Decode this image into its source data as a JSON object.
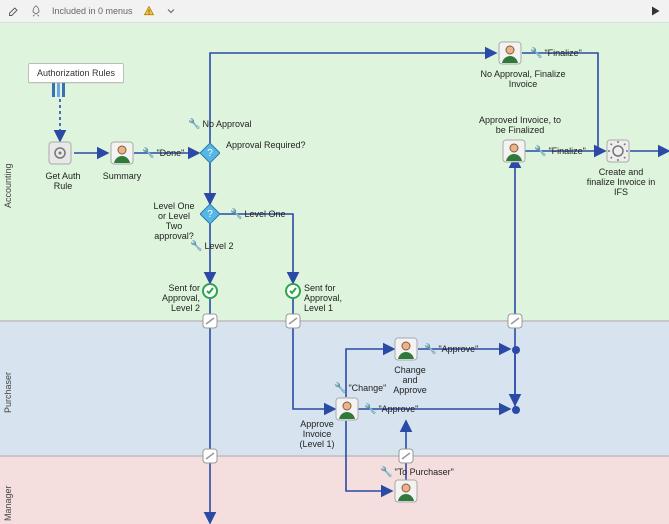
{
  "toolbar": {
    "menus_text": "Included in 0 menus",
    "warning_icon": "warning",
    "dropdown_icon": "caret-down",
    "pencil_icon": "pencil",
    "rocket_icon": "rocket",
    "play_icon": "play"
  },
  "lanes": {
    "accounting": "Accounting",
    "purchaser": "Purchaser",
    "manager": "Manager"
  },
  "note": {
    "auth_rules": "Authorization Rules"
  },
  "tasks": {
    "get_auth_rule": "Get Auth Rule",
    "summary": "Summary",
    "create_finalize": "Create and finalize Invoice in IFS",
    "change_approve": "Change\nand Approve",
    "approve_inv_l1": "Approve\nInvoice\n(Level 1)",
    "no_approval_finalize": "No Approval, Finalize\nInvoice",
    "approved_to_finalize": "Approved Invoice, to\nbe Finalized",
    "sent_l2": "Sent for Approval,\nLevel 2",
    "sent_l1": "Sent for Approval,\nLevel 1"
  },
  "edges": {
    "done": "\"Done\"",
    "approval_required": "Approval Required?",
    "no_approval": "No Approval",
    "level_one_or_two": "Level One or Level\nTwo approval?",
    "level_one": "Level One",
    "level2": "Level 2",
    "finalize1": "\"Finalize\"",
    "finalize2": "\"Finalize\"",
    "approve1": "\"Approve\"",
    "approve2": "\"Approve\"",
    "change": "\"Change\"",
    "to_purchaser": "\"To Purchaser\""
  }
}
